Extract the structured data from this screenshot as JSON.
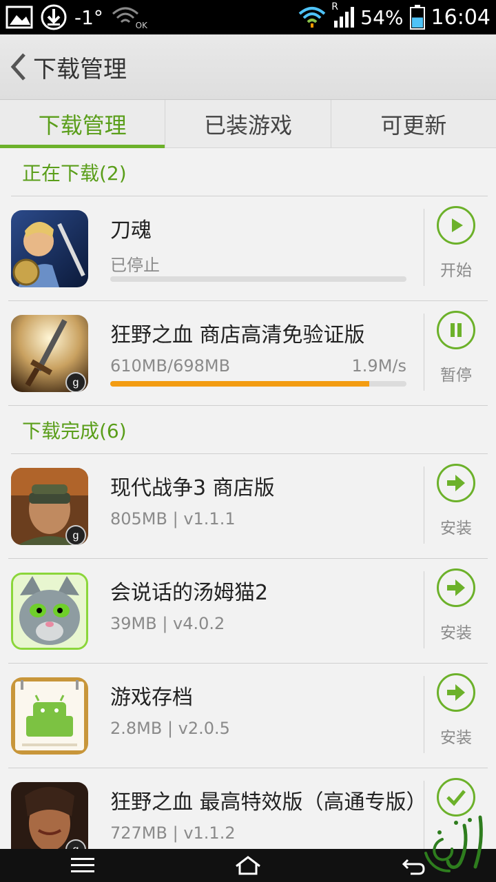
{
  "status_bar": {
    "temperature": "-1°",
    "wifi_ok": "OK",
    "roaming": "R",
    "battery_percent": "54%",
    "time": "16:04",
    "battery_level": 0.54
  },
  "header": {
    "title": "下载管理"
  },
  "tabs": [
    {
      "label": "下载管理",
      "active": true
    },
    {
      "label": "已装游戏",
      "active": false
    },
    {
      "label": "可更新",
      "active": false
    }
  ],
  "sections": {
    "downloading": {
      "title": "正在下载(2)",
      "items": [
        {
          "name": "刀魂",
          "status": "已停止",
          "progress": 0.0,
          "action": "开始",
          "action_icon": "play-icon"
        },
        {
          "name": "狂野之血 商店高清免验证版",
          "size": "610MB/698MB",
          "speed": "1.9M/s",
          "progress": 0.874,
          "action": "暂停",
          "action_icon": "pause-icon"
        }
      ]
    },
    "completed": {
      "title": "下载完成(6)",
      "items": [
        {
          "name": "现代战争3 商店版",
          "meta": "805MB | v1.1.1",
          "action": "安装",
          "action_icon": "arrow-right-icon"
        },
        {
          "name": "会说话的汤姆猫2",
          "meta": "39MB | v4.0.2",
          "action": "安装",
          "action_icon": "arrow-right-icon"
        },
        {
          "name": "游戏存档",
          "meta": "2.8MB | v2.0.5",
          "action": "安装",
          "action_icon": "arrow-right-icon"
        },
        {
          "name": "狂野之血 最高特效版（高通专版）",
          "meta": "727MB | v1.1.2",
          "action": "",
          "action_icon": "checkmark-icon"
        }
      ]
    }
  },
  "colors": {
    "accent": "#6cb12a",
    "progress": "#f39c12"
  }
}
